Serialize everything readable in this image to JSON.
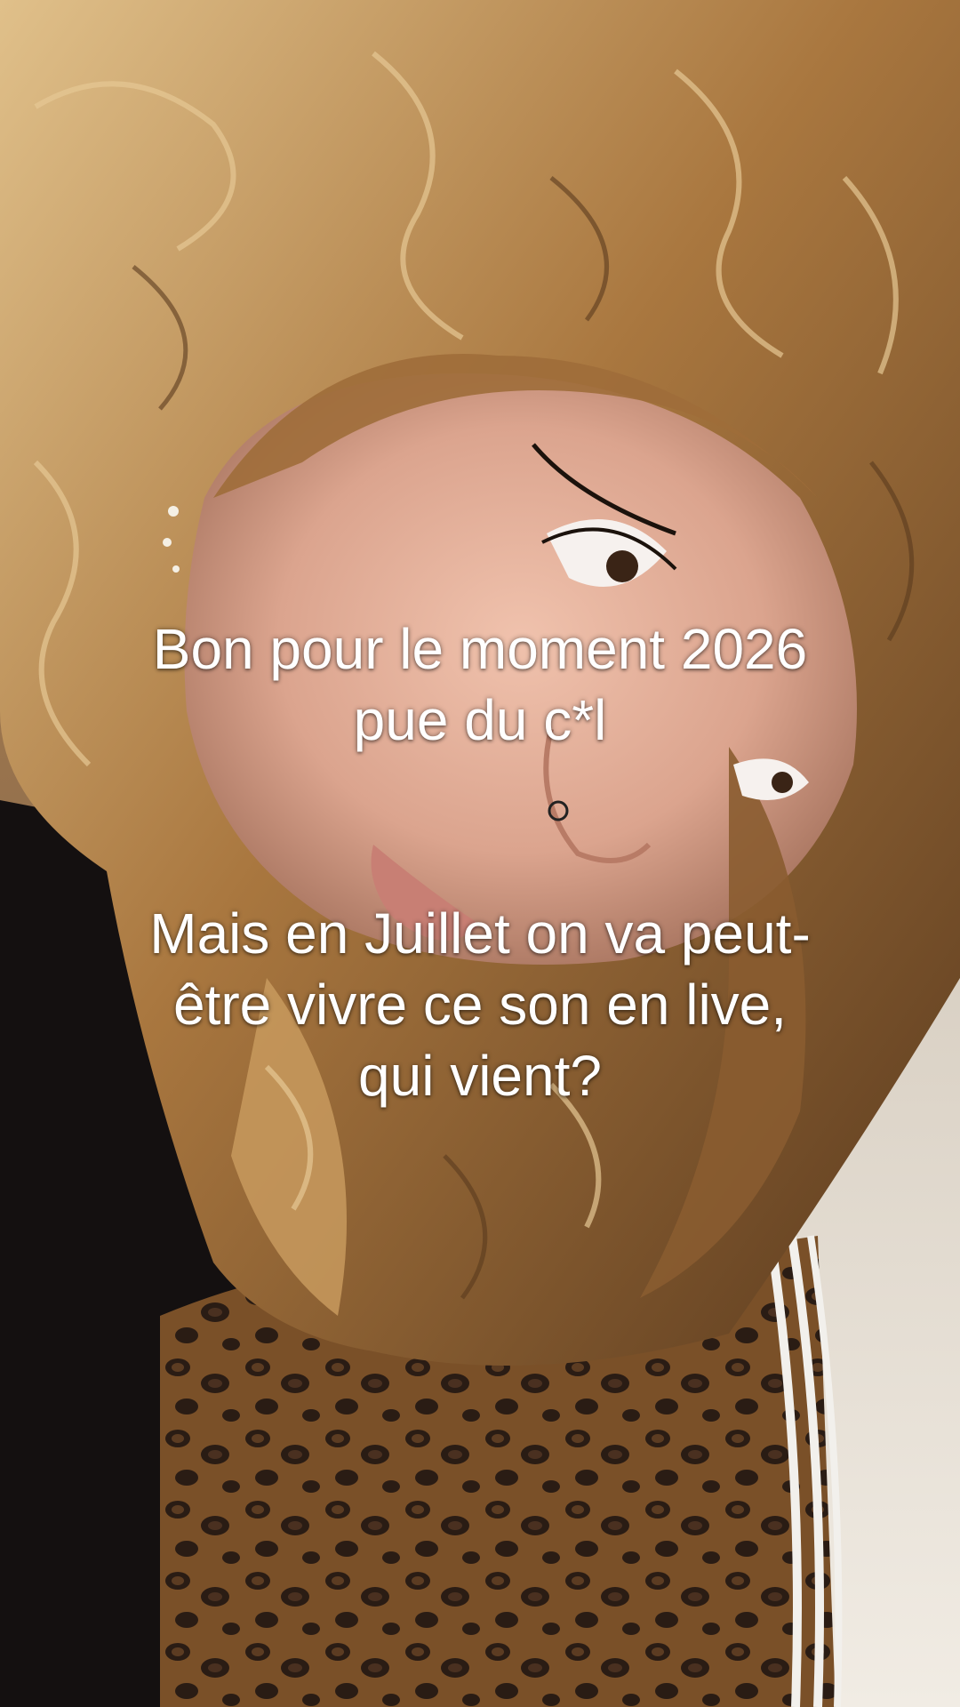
{
  "captions": {
    "line_group_1": "Bon pour le moment 2026\npue du c*l",
    "line_group_2": "Mais en Juillet on va peut-\nêtre vivre ce son en live,\nqui vient?"
  },
  "photo": {
    "subject": "close-up selfie portrait with curly blonde hair and leopard-print jacket"
  },
  "colors": {
    "caption_text": "#ffffff",
    "hair": "#b58a55",
    "skin": "#e7b39f",
    "background_wall": "#e8e2d8",
    "jacket_base": "#6b4526"
  }
}
